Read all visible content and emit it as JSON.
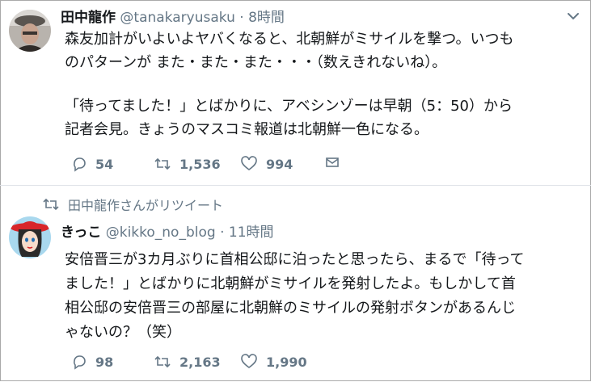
{
  "tweets": [
    {
      "name": "田中龍作",
      "handle": "@tanakaryusaku",
      "separator": "·",
      "time": "8時間",
      "lines": [
        "森友加計がいよいよヤバくなると、北朝鮮がミサイルを撃つ。いつも",
        "のパターンが また・また・また・・・（数えきれないね）。",
        "",
        "「待ってました！」とばかりに、アベシンゾーは早朝（5：50）から",
        "記者会見。きょうのマスコミ報道は北朝鮮一色になる。"
      ],
      "replies": "54",
      "retweets": "1,536",
      "likes": "994",
      "icons": {
        "avatar": "avatar-photo",
        "reply": "reply-icon",
        "retweet": "retweet-icon",
        "like": "heart-icon",
        "dm": "envelope-icon",
        "menu": "chevron-down-icon"
      }
    },
    {
      "retweet_context": "田中龍作さんがリツイート",
      "name": "きっこ",
      "handle": "@kikko_no_blog",
      "separator": "·",
      "time": "11時間",
      "lines": [
        "安倍晋三が3カ月ぶりに首相公邸に泊ったと思ったら、まるで「待って",
        "ました！」とばかりに北朝鮮がミサイルを発射したよ。もしかして首",
        "相公邸の安倍晋三の部屋に北朝鮮のミサイルの発射ボタンがあるんじ",
        "ゃないの？（笑）"
      ],
      "replies": "98",
      "retweets": "2,163",
      "likes": "1,990",
      "icons": {
        "avatar": "avatar-illustration",
        "reply": "reply-icon",
        "retweet": "retweet-icon",
        "like": "heart-icon",
        "dm": "envelope-icon"
      }
    }
  ],
  "colors": {
    "text": "#14171a",
    "secondary": "#657786",
    "divider": "#dfe3e8"
  }
}
